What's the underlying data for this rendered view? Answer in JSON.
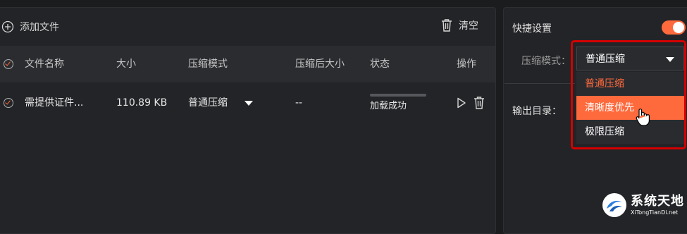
{
  "toolbar": {
    "add_file_label": "添加文件",
    "clear_label": "清空"
  },
  "table": {
    "headers": {
      "name": "文件名称",
      "size": "大小",
      "mode": "压缩模式",
      "compressed_size": "压缩后大小",
      "status": "状态",
      "actions": "操作"
    },
    "rows": [
      {
        "name": "需提供证件...",
        "size": "110.89 KB",
        "mode": "普通压缩",
        "compressed_size": "--",
        "status": "加载成功",
        "progress": 1.0
      }
    ]
  },
  "quick_settings": {
    "title": "快捷设置",
    "enabled": true,
    "compress_mode_label": "压缩模式：",
    "compress_mode_value": "普通压缩",
    "options": [
      "普通压缩",
      "清晰度优先",
      "极限压缩"
    ],
    "selected_option": "普通压缩",
    "hovered_option": "清晰度优先",
    "output_dir_label": "输出目录："
  },
  "watermark": {
    "name": "系统天地",
    "url": "XiTongTianDi.net"
  },
  "colors": {
    "accent": "#ff6a3d",
    "highlight_border": "#d40000",
    "background": "#1b1c1e",
    "panel": "#232427"
  }
}
